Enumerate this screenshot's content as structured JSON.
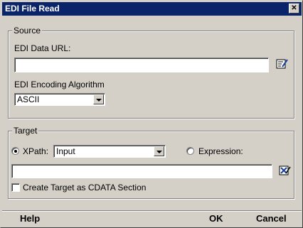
{
  "window": {
    "title": "EDI File Read",
    "close_glyph": "✕"
  },
  "source": {
    "legend": "Source",
    "url_label": "EDI Data URL:",
    "url_value": "",
    "encoding_label": "EDI Encoding Algorithm",
    "encoding_value": "ASCII"
  },
  "target": {
    "legend": "Target",
    "xpath_label": "XPath:",
    "xpath_selected": true,
    "xpath_value": "Input",
    "expression_label": "Expression:",
    "expression_selected": false,
    "target_value": "",
    "cdata_label": "Create Target as CDATA Section",
    "cdata_checked": false
  },
  "buttons": {
    "help": "Help",
    "ok": "OK",
    "cancel": "Cancel"
  },
  "icons": {
    "url_editor": "edit-pencil-icon",
    "target_editor": "xpath-editor-icon"
  },
  "colors": {
    "face": "#d4d0c8",
    "titlebar": "#0a246a"
  }
}
